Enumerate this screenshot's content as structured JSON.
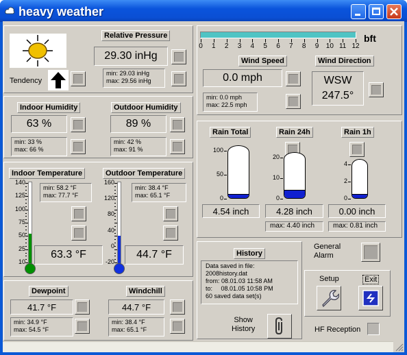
{
  "window": {
    "title": "heavy weather"
  },
  "pressure": {
    "label": "Relative Pressure",
    "value": "29.30 inHg",
    "min": "min: 29.03 inHg",
    "max": "max: 29.56 inHg",
    "tendency_label": "Tendency"
  },
  "wind": {
    "scale_unit": "bft",
    "scale_ticks": [
      "0",
      "1",
      "2",
      "3",
      "4",
      "5",
      "6",
      "7",
      "8",
      "9",
      "10",
      "11",
      "12"
    ],
    "scale_fill_fraction": 1.0,
    "speed_label": "Wind Speed",
    "speed_value": "0.0 mph",
    "speed_min": "min: 0.0 mph",
    "speed_max": "max: 22.5 mph",
    "dir_label": "Wind Direction",
    "dir_value": "WSW",
    "dir_deg": "247.5°"
  },
  "indoor_humidity": {
    "label": "Indoor Humidity",
    "value": "63 %",
    "min": "min: 33 %",
    "max": "max: 66 %"
  },
  "outdoor_humidity": {
    "label": "Outdoor Humidity",
    "value": "89 %",
    "min": "min: 42 %",
    "max": "max: 91 %"
  },
  "indoor_temp": {
    "label": "Indoor Temperature",
    "value": "63.3 °F",
    "min": "min: 58.2 °F",
    "max": "max: 77.7 °F",
    "ticks": [
      "140",
      "125",
      "100",
      "75",
      "50",
      "25",
      "10"
    ],
    "fill_fraction": 0.39
  },
  "outdoor_temp": {
    "label": "Outdoor Temperature",
    "value": "44.7 °F",
    "min": "min: 38.4 °F",
    "max": "max: 65.1 °F",
    "ticks": [
      "160",
      "120",
      "80",
      "40",
      "0",
      "-20"
    ],
    "fill_fraction": 0.36
  },
  "rain": {
    "total": {
      "label": "Rain Total",
      "value": "4.54 inch",
      "ticks": [
        "100",
        "50",
        "0"
      ],
      "fill_fraction": 0.05
    },
    "day": {
      "label": "Rain 24h",
      "value": "4.28 inch",
      "max": "max: 4.40 inch",
      "ticks": [
        "20",
        "10",
        "0"
      ],
      "fill_fraction": 0.2
    },
    "hour": {
      "label": "Rain 1h",
      "value": "0.00 inch",
      "max": "max: 0.81 inch",
      "ticks": [
        "4",
        "2",
        "0"
      ],
      "fill_fraction": 0.02
    }
  },
  "dewpoint": {
    "label": "Dewpoint",
    "value": "41.7 °F",
    "min": "min: 34.9 °F",
    "max": "max: 54.5 °F"
  },
  "windchill": {
    "label": "Windchill",
    "value": "44.7 °F",
    "min": "min: 38.4 °F",
    "max": "max: 65.1 °F"
  },
  "history": {
    "label": "History",
    "lines": [
      "Data saved in file:",
      "2008history.dat",
      "from: 08.01.03 11:58 AM",
      "to:     08.01.05 10:58 PM",
      "60 saved data set(s)"
    ],
    "show_label_1": "Show",
    "show_label_2": "History"
  },
  "alarm": {
    "label_1": "General",
    "label_2": "Alarm"
  },
  "controls": {
    "setup_label": "Setup",
    "exit_label": "Exit",
    "hf_label": "HF Reception"
  },
  "colors": {
    "title_bar": "#0a54dc",
    "face": "#d4d0c8",
    "thermo_indoor": "#009000",
    "thermo_outdoor": "#1030e0",
    "rain_fill": "#1020d0",
    "wind_bar": "#4fc4c4"
  }
}
